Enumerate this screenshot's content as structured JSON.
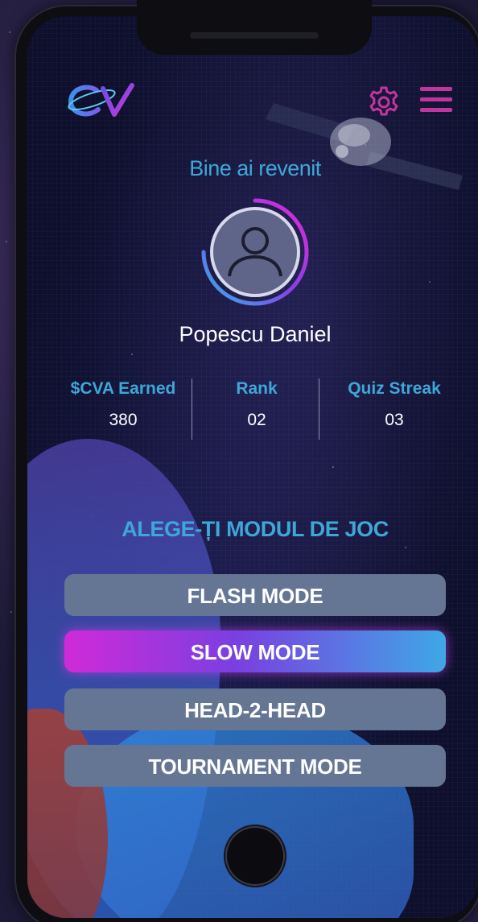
{
  "header": {
    "logo_icon": "ev-logo-icon",
    "settings_icon": "gear-icon",
    "menu_icon": "hamburger-menu-icon"
  },
  "greeting": "Bine ai revenit",
  "profile": {
    "avatar_icon": "user-avatar-icon",
    "name": "Popescu Daniel"
  },
  "stats": [
    {
      "label": "$CVA Earned",
      "value": "380"
    },
    {
      "label": "Rank",
      "value": "02"
    },
    {
      "label": "Quiz Streak",
      "value": "03"
    }
  ],
  "mode_section": {
    "title": "ALEGE-ȚI MODUL DE JOC",
    "modes": [
      {
        "label": "FLASH MODE",
        "selected": false
      },
      {
        "label": "SLOW MODE",
        "selected": true
      },
      {
        "label": "HEAD-2-HEAD",
        "selected": false
      },
      {
        "label": "TOURNAMENT MODE",
        "selected": false
      }
    ]
  },
  "colors": {
    "accent_blue": "#3fa7d8",
    "accent_magenta": "#c3359c",
    "button_gray": "#647694"
  }
}
